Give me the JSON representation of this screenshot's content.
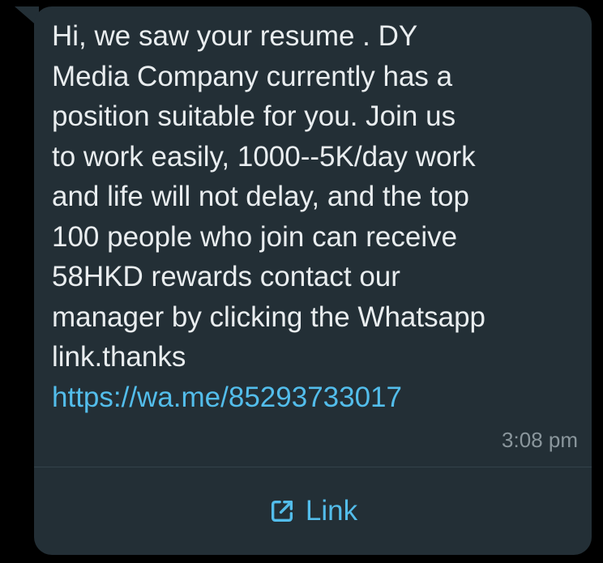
{
  "message": {
    "lines": [
      "Hi, we saw your resume . DY",
      "Media Company currently has a",
      "position suitable for you. Join us",
      "to work easily, 1000--5K/day work",
      "and life will not delay, and the top",
      "100 people who join can receive",
      "58HKD rewards contact our",
      "manager by clicking the Whatsapp",
      "link.thanks"
    ],
    "url": "https://wa.me/85293733017",
    "timestamp": "3:08 pm"
  },
  "action": {
    "label": "Link",
    "icon": "external-link-icon"
  },
  "colors": {
    "bubble": "#232f36",
    "text": "#e9edef",
    "link": "#53bdeb",
    "timestamp": "#8a969c",
    "background": "#000000"
  }
}
